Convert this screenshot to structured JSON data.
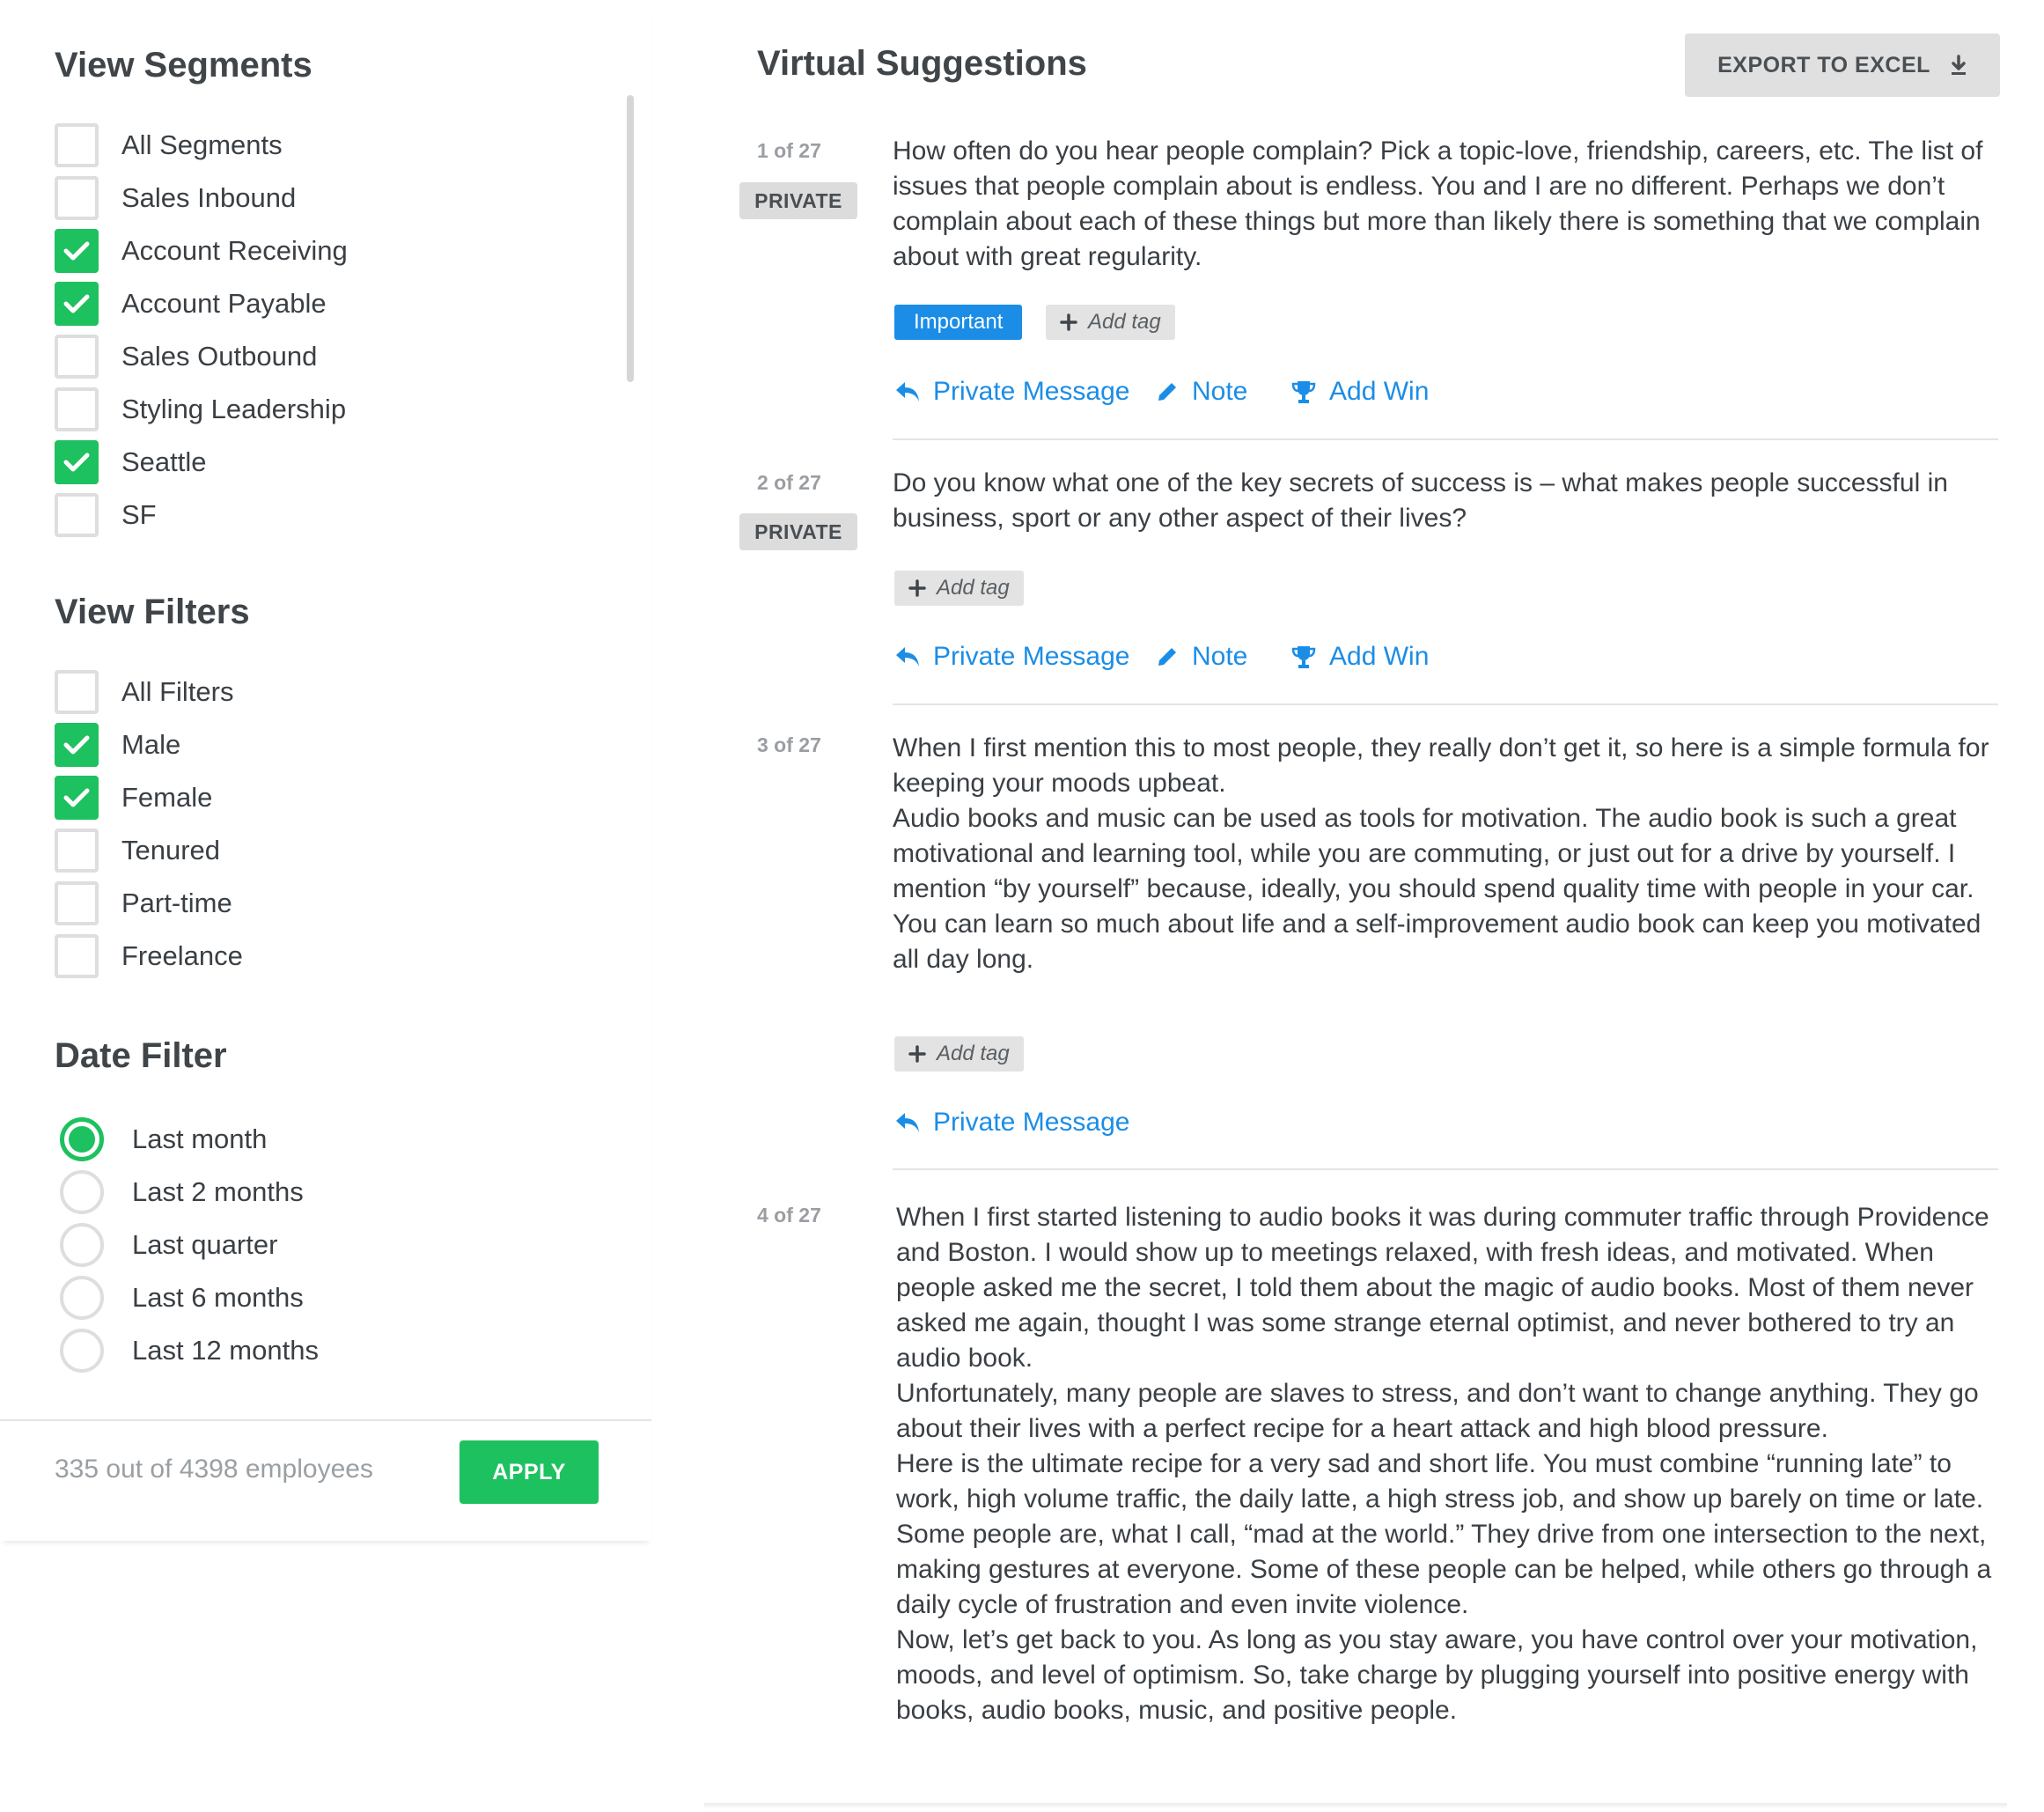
{
  "segments": {
    "title": "View Segments",
    "items": [
      {
        "label": "All Segments",
        "checked": false
      },
      {
        "label": "Sales Inbound",
        "checked": false
      },
      {
        "label": "Account Receiving",
        "checked": true
      },
      {
        "label": "Account Payable",
        "checked": true
      },
      {
        "label": "Sales Outbound",
        "checked": false
      },
      {
        "label": "Styling Leadership",
        "checked": false
      },
      {
        "label": "Seattle",
        "checked": true
      },
      {
        "label": "SF",
        "checked": false
      }
    ]
  },
  "filters": {
    "title": "View Filters",
    "items": [
      {
        "label": "All Filters",
        "checked": false
      },
      {
        "label": "Male",
        "checked": true
      },
      {
        "label": "Female",
        "checked": true
      },
      {
        "label": "Tenured",
        "checked": false
      },
      {
        "label": "Part-time",
        "checked": false
      },
      {
        "label": "Freelance",
        "checked": false
      }
    ]
  },
  "date_filter": {
    "title": "Date Filter",
    "selected": "Last month",
    "options": [
      "Last month",
      "Last 2 months",
      "Last quarter",
      "Last 6 months",
      "Last 12 months"
    ]
  },
  "footer": {
    "employee_count": "335 out of 4398 employees",
    "apply_label": "APPLY"
  },
  "main": {
    "title": "Virtual Suggestions",
    "export_label": "EXPORT TO EXCEL",
    "export_icon": "download-icon"
  },
  "colors": {
    "accent_green": "#1ec15f",
    "link_blue": "#1b8de6",
    "tag_blue": "#1b8de6",
    "badge_gray": "#dcdcdc"
  },
  "suggestions": [
    {
      "counter": "1 of 27",
      "badge": "PRIVATE",
      "text": "How often do you hear people complain? Pick a topic-love, friendship, careers, etc. The list of issues that people complain about is endless. You and I are no different. Perhaps we don’t complain about each of these things but more than likely there is something that we complain about with great regularity.",
      "tags": [
        "Important"
      ],
      "add_tag_label": "Add tag",
      "actions": [
        "Private Message",
        "Note",
        "Add Win"
      ]
    },
    {
      "counter": "2 of 27",
      "badge": "PRIVATE",
      "text": "Do you know what one of the key secrets of success is – what makes people successful in business, sport or any other aspect of their lives?",
      "tags": [],
      "add_tag_label": "Add tag",
      "actions": [
        "Private Message",
        "Note",
        "Add Win"
      ]
    },
    {
      "counter": "3 of 27",
      "badge": "",
      "text": "When I first mention this to most people, they really don’t get it, so here is a simple formula for keeping your moods upbeat.\nAudio books and music can be used as tools for motivation. The audio book is such a great motivational and learning tool, while you are commuting, or just out for a drive by yourself. I mention “by yourself” because, ideally, you should spend quality time with people in your car.\nYou can learn so much about life and a self-improvement audio book can keep you motivated all day long.",
      "tags": [],
      "add_tag_label": "Add tag",
      "actions": [
        "Private Message"
      ]
    },
    {
      "counter": "4 of 27",
      "badge": "",
      "text": "When I first started listening to audio books it was during commuter traffic through Providence and Boston. I would show up to meetings relaxed, with fresh ideas, and motivated. When people asked me the secret, I told them about the magic of audio books. Most of them never asked me again, thought I was some strange eternal optimist, and never bothered to try an audio book.\nUnfortunately, many people are slaves to stress, and don’t want to change anything. They go about their lives with a perfect recipe for a heart attack and high blood pressure.\nHere is the ultimate recipe for a very sad and short life. You must combine “running late” to work, high volume traffic, the daily latte, a high stress job, and show up barely on time or late.\nSome people are, what I call, “mad at the world.” They drive from one intersection to the next, making gestures at everyone. Some of these people can be helped, while others go through a daily cycle of frustration and even invite violence.\nNow, let’s get back to you. As long as you stay aware, you have control over your motivation, moods, and level of optimism. So, take charge by plugging yourself into positive energy with books, audio books, music, and positive people.",
      "tags": [],
      "actions": []
    }
  ]
}
